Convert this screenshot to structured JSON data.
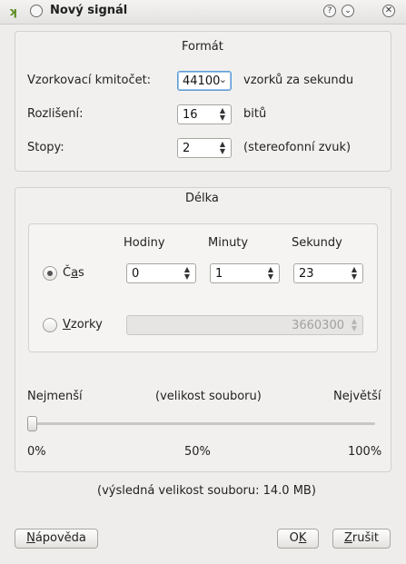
{
  "window": {
    "title": "Nový signál",
    "help_button": "?",
    "menu_button": "⌄"
  },
  "format": {
    "title": "Formát",
    "sample_rate_label": "Vzorkovací kmitočet:",
    "sample_rate_value": "44100",
    "sample_rate_unit": "vzorků za sekundu",
    "resolution_label": "Rozlišení:",
    "resolution_value": "16",
    "resolution_unit": "bitů",
    "tracks_label": "Stopy:",
    "tracks_value": "2",
    "tracks_unit": "(stereofonní zvuk)"
  },
  "length": {
    "title": "Délka",
    "col_hours": "Hodiny",
    "col_minutes": "Minuty",
    "col_seconds": "Sekundy",
    "time_radio": {
      "label_pre": "Č",
      "label_ul": "a",
      "label_post": "s",
      "checked": true
    },
    "hours_value": "0",
    "minutes_value": "1",
    "seconds_value": "23",
    "samples_radio": {
      "label_ul": "V",
      "label_post": "zorky",
      "checked": false
    },
    "samples_value": "3660300"
  },
  "size": {
    "min_label": "Nejmenší",
    "mid_label": "(velikost souboru)",
    "max_label": "Největší",
    "pct_min": "0%",
    "pct_mid": "50%",
    "pct_max": "100%",
    "slider_value": 0,
    "result": "(výsledná velikost souboru: 14.0 MB)"
  },
  "buttons": {
    "help": {
      "ul": "N",
      "rest": "ápověda"
    },
    "ok": {
      "pre": "O",
      "ul": "K"
    },
    "cancel": {
      "ul": "Z",
      "rest": "rušit"
    }
  },
  "colors": {
    "focus": "#5b9bd5",
    "background": "#eeedeb"
  }
}
